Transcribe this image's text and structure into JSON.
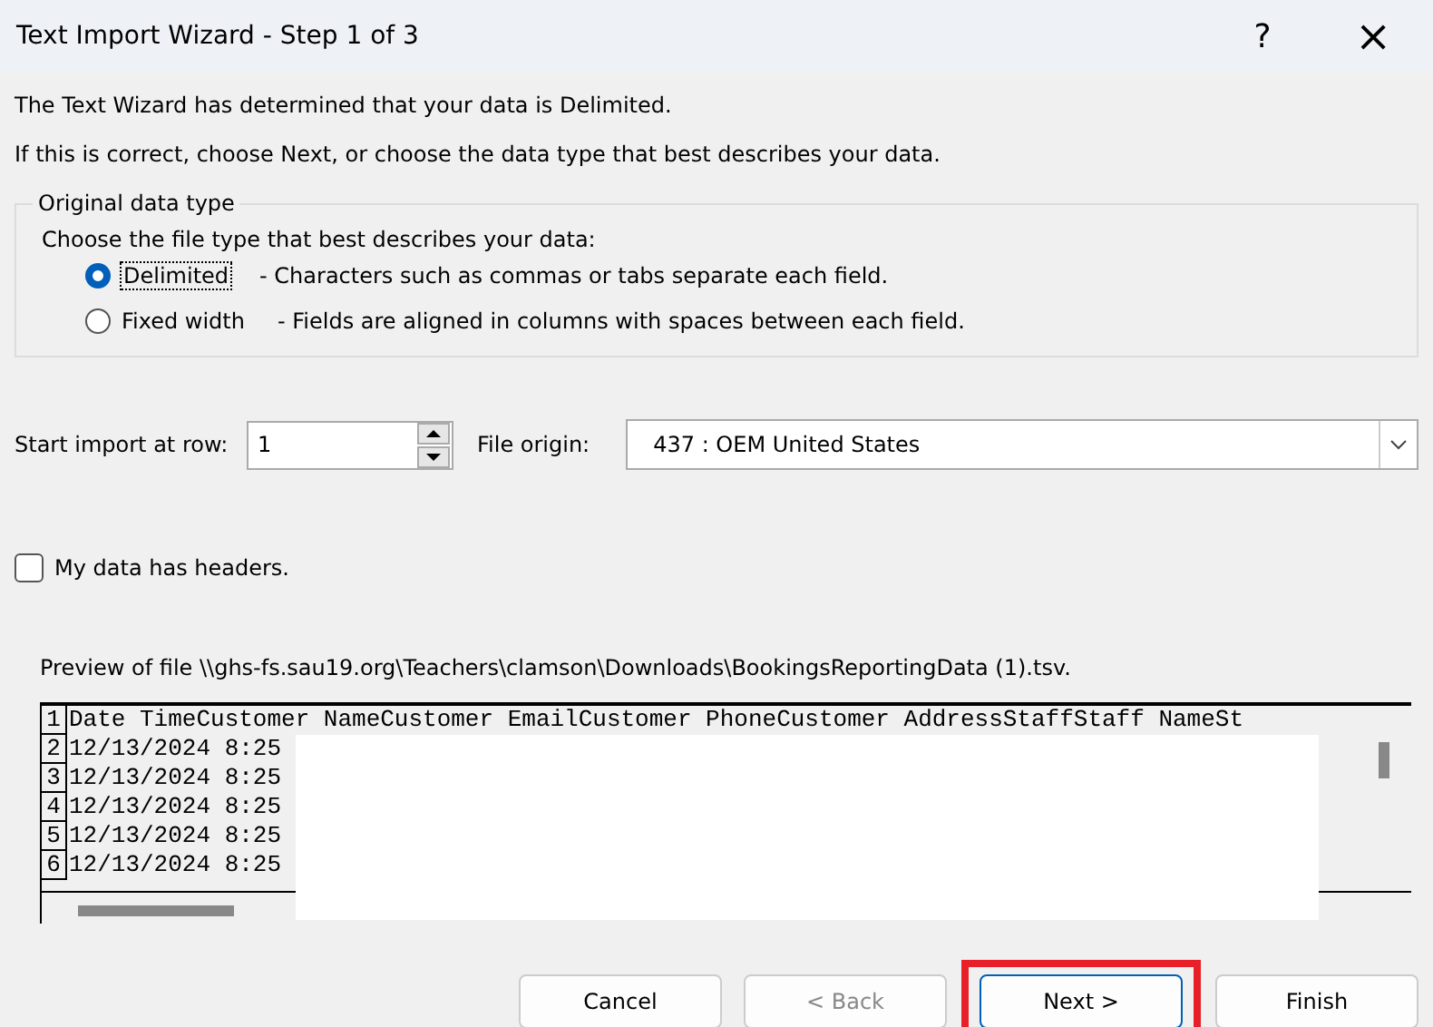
{
  "window": {
    "title": "Text Import Wizard - Step 1 of 3",
    "help": "?",
    "close": "×"
  },
  "intro": [
    "The Text Wizard has determined that your data is Delimited.",
    "If this is correct, choose Next, or choose the data type that best describes your data."
  ],
  "data_type_group": {
    "legend": "Original data type",
    "prompt": "Choose the file type that best describes your data:",
    "options": [
      {
        "label": "Delimited",
        "description": "- Characters such as commas or tabs separate each field.",
        "selected": true
      },
      {
        "label": "Fixed width",
        "description": "- Fields are aligned in columns with spaces between each field.",
        "selected": false
      }
    ]
  },
  "start_row": {
    "label": "Start import at row:",
    "value": "1"
  },
  "file_origin": {
    "label": "File origin:",
    "value": "437 : OEM United States"
  },
  "headers_checkbox": {
    "label": "My data has headers.",
    "checked": false
  },
  "preview": {
    "label": "Preview of file \\\\ghs-fs.sau19.org\\Teachers\\clamson\\Downloads\\BookingsReportingData (1).tsv.",
    "rows": [
      {
        "number": "1",
        "text": "Date TimeCustomer NameCustomer EmailCustomer PhoneCustomer AddressStaffStaff NameSt"
      },
      {
        "number": "2",
        "text": "12/13/2024 8:25"
      },
      {
        "number": "3",
        "text": "12/13/2024 8:25"
      },
      {
        "number": "4",
        "text": "12/13/2024 8:25"
      },
      {
        "number": "5",
        "text": "12/13/2024 8:25"
      },
      {
        "number": "6",
        "text": "12/13/2024 8:25"
      }
    ]
  },
  "buttons": [
    {
      "label": "Cancel",
      "disabled": false,
      "highlighted": false
    },
    {
      "label": "< Back",
      "disabled": true,
      "highlighted": false
    },
    {
      "label": "Next >",
      "disabled": false,
      "highlighted": true
    },
    {
      "label": "Finish",
      "disabled": false,
      "highlighted": false
    }
  ]
}
